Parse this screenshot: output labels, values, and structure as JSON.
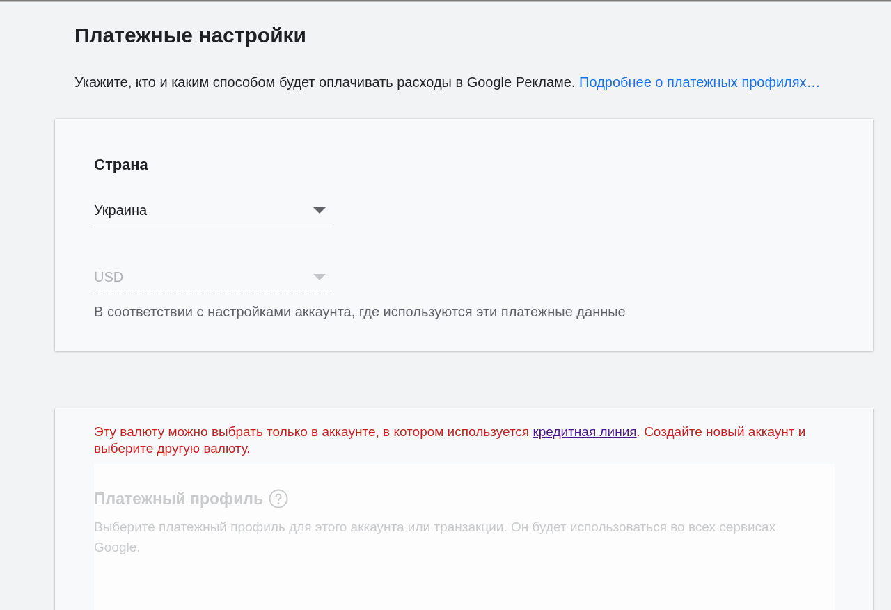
{
  "title": "Платежные настройки",
  "intro": {
    "text": "Укажите, кто и каким способом будет оплачивать расходы в Google Рекламе.",
    "link": "Подробнее о платежных профилях…"
  },
  "country_card": {
    "heading": "Страна",
    "country_select": {
      "value": "Украина",
      "disabled": false
    },
    "currency_select": {
      "value": "USD",
      "disabled": true
    },
    "currency_hint": "В соответствии с настройками аккаунта, где используются эти платежные данные"
  },
  "payment_card": {
    "error": {
      "text_before": "Эту валюту можно выбрать только в аккаунте, в котором используется",
      "link": "кредитная линия",
      "text_after": ". Создайте новый аккаунт и выберите другую валюту."
    },
    "profile": {
      "heading": "Платежный профиль",
      "description": "Выберите платежный профиль для этого аккаунта или транзакции. Он будет использоваться во всех сервисах Google.",
      "disabled": true
    }
  }
}
